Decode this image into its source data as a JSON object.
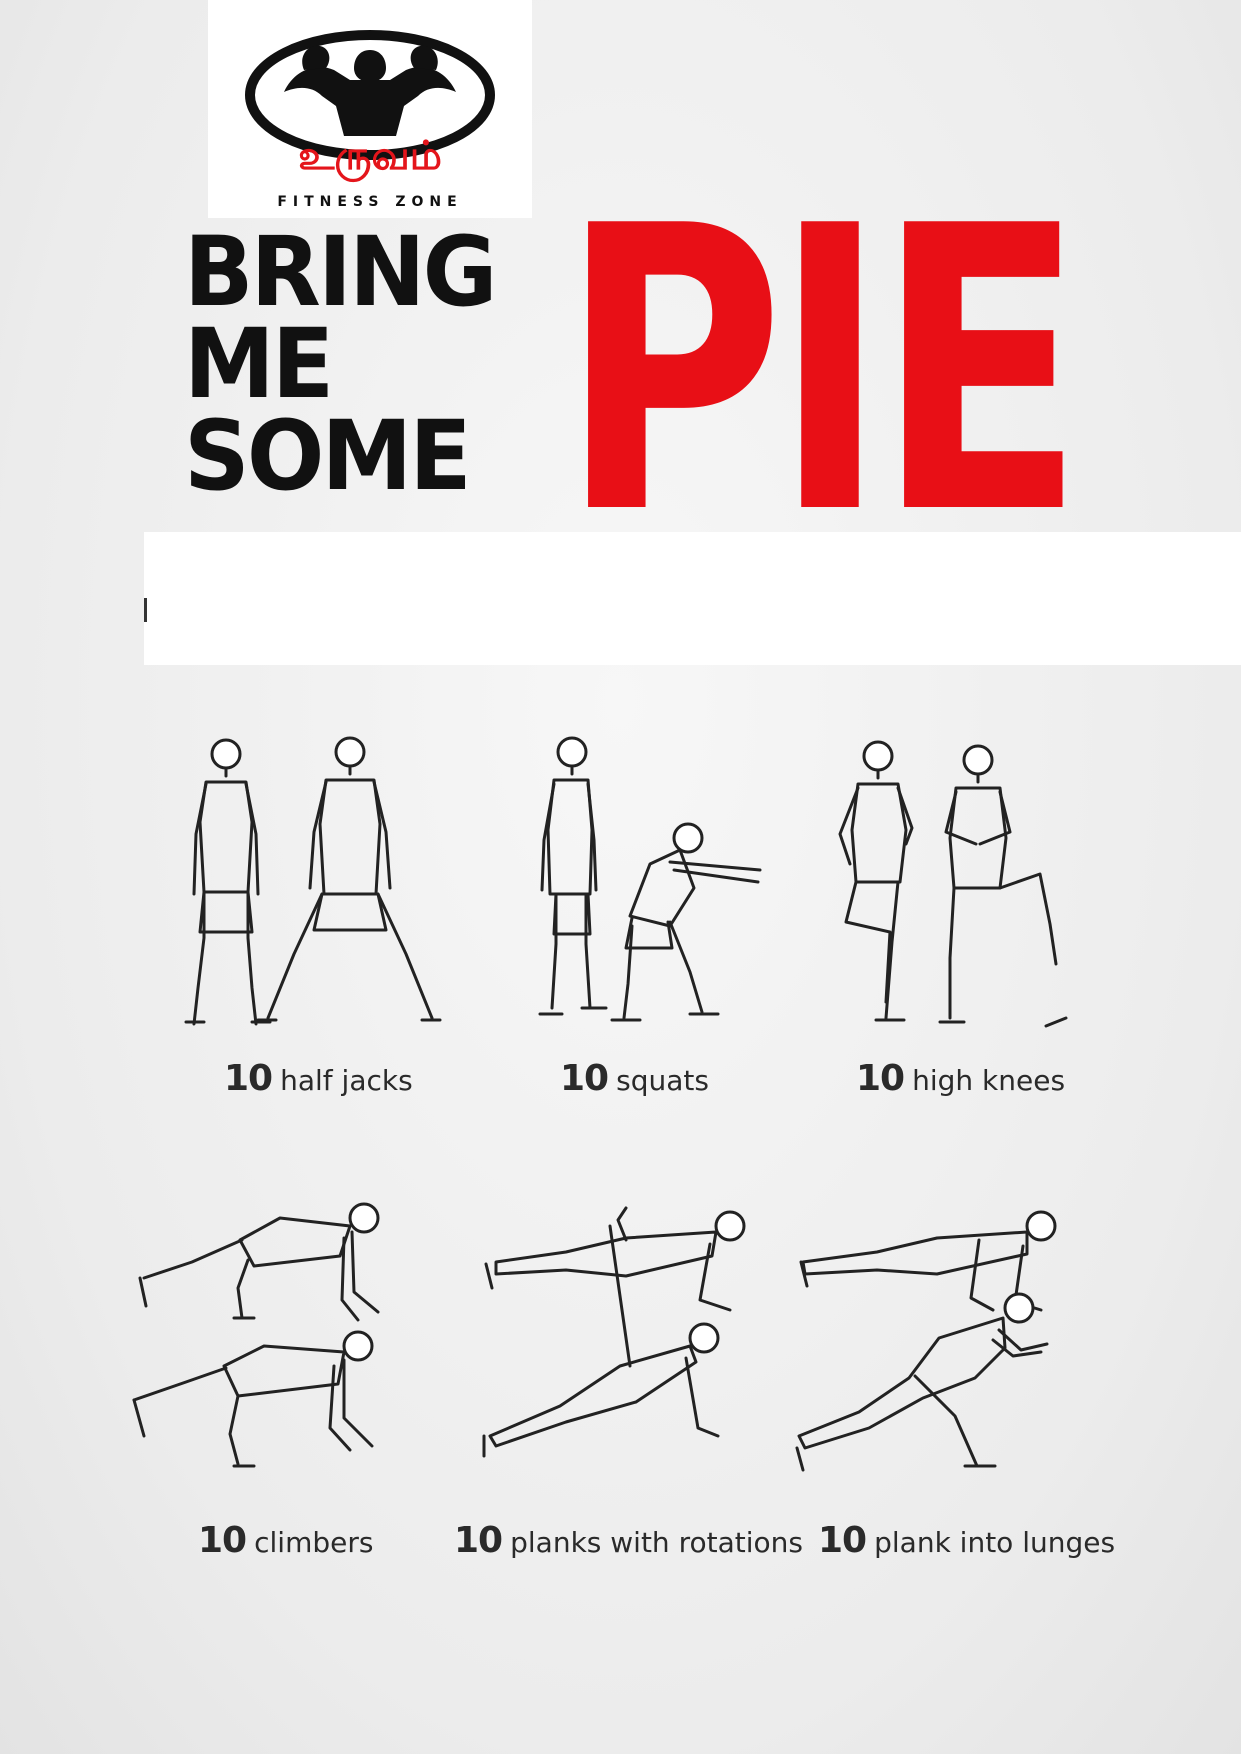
{
  "logo": {
    "script_text": "உருவம்",
    "tagline": "FITNESS ZONE"
  },
  "title": {
    "lines": [
      "BRING",
      "ME",
      "SOME"
    ],
    "highlight": "PIE"
  },
  "colors": {
    "accent": "#e80f16",
    "text": "#2a2a2a"
  },
  "exercises": [
    {
      "count": "10",
      "name": "half jacks"
    },
    {
      "count": "10",
      "name": "squats"
    },
    {
      "count": "10",
      "name": "high knees"
    },
    {
      "count": "10",
      "name": "climbers"
    },
    {
      "count": "10",
      "name": "planks with rotations"
    },
    {
      "count": "10",
      "name": "plank into lunges"
    }
  ]
}
